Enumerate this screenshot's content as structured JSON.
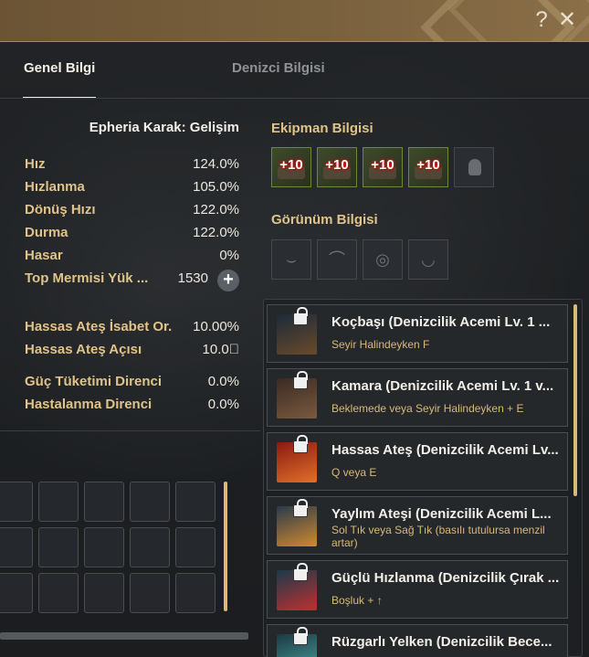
{
  "header": {
    "help_icon": "?",
    "close_icon": "✕"
  },
  "tabs": [
    {
      "label": "Genel Bilgi",
      "active": true
    },
    {
      "label": "Denizci Bilgisi",
      "active": false
    }
  ],
  "ship": {
    "title": "Epheria Karak: Gelişim",
    "stats": [
      {
        "label": "Hız",
        "value": "124.0%"
      },
      {
        "label": "Hızlanma",
        "value": "105.0%"
      },
      {
        "label": "Dönüş Hızı",
        "value": "122.0%"
      },
      {
        "label": "Durma",
        "value": "122.0%"
      },
      {
        "label": "Hasar",
        "value": "0%"
      }
    ],
    "ammo": {
      "label": "Top Mermisi Yük ...",
      "value": "1530",
      "add": "+"
    },
    "cannon_stats": [
      {
        "label": "Hassas Ateş İsabet Or.",
        "value": "10.00%"
      },
      {
        "label": "Hassas Ateş Açısı",
        "value": "10.0⃝"
      }
    ],
    "resist_stats": [
      {
        "label": "Güç Tüketimi Direnci",
        "value": "0.0%"
      },
      {
        "label": "Hastalanma Direnci",
        "value": "0.0%"
      }
    ]
  },
  "equipment": {
    "title": "Ekipman Bilgisi",
    "slots": [
      "+10",
      "+10",
      "+10",
      "+10"
    ],
    "empty_slot_icon": "sailor-icon"
  },
  "appearance": {
    "title": "Görünüm Bilgisi",
    "slots": [
      "prow-icon",
      "figurehead-icon",
      "cannon-icon",
      "sail-icon"
    ]
  },
  "skills": [
    {
      "name": "Koçbaşı (Denizcilik Acemi Lv. 1 ...",
      "key": "Seyir Halindeyken F",
      "colors": [
        "#1c2a3a",
        "#6a4a2a"
      ]
    },
    {
      "name": "Kamara (Denizcilik Acemi Lv. 1 v...",
      "key": "Beklemede veya Seyir Halindeyken + E",
      "colors": [
        "#3a2a22",
        "#7a5a40"
      ]
    },
    {
      "name": "Hassas Ateş (Denizcilik Acemi Lv...",
      "key": "Q veya E",
      "colors": [
        "#8a1a10",
        "#e0702a"
      ]
    },
    {
      "name": "Yaylım Ateşi (Denizcilik Acemi L...",
      "key": "Sol Tık veya Sağ Tık (basılı tutulursa menzil artar)",
      "colors": [
        "#2a3a4a",
        "#d08a30"
      ]
    },
    {
      "name": "Güçlü Hızlanma (Denizcilik Çırak ...",
      "key": "Boşluk + ↑",
      "colors": [
        "#1a3a4a",
        "#c03030"
      ]
    },
    {
      "name": "Rüzgarlı Yelken (Denizcilik Bece...",
      "key": "",
      "colors": [
        "#1a3a40",
        "#4aa0a0"
      ]
    }
  ]
}
